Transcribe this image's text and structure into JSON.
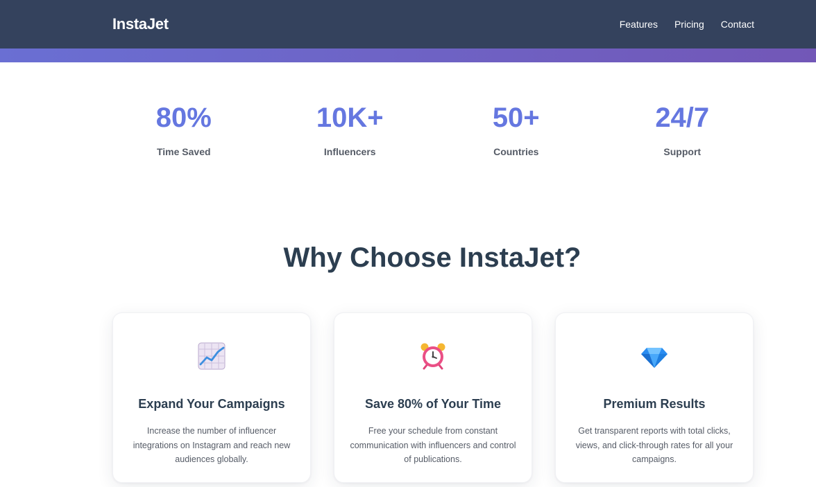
{
  "header": {
    "brand": "InstaJet",
    "nav": [
      "Features",
      "Pricing",
      "Contact"
    ]
  },
  "stats": [
    {
      "value": "80%",
      "label": "Time Saved"
    },
    {
      "value": "10K+",
      "label": "Influencers"
    },
    {
      "value": "50+",
      "label": "Countries"
    },
    {
      "value": "24/7",
      "label": "Support"
    }
  ],
  "section": {
    "title": "Why Choose InstaJet?"
  },
  "features": [
    {
      "icon": "chart-increasing-icon",
      "title": "Expand Your Campaigns",
      "description": "Increase the number of influencer integrations on Instagram and reach new audiences globally."
    },
    {
      "icon": "alarm-clock-icon",
      "title": "Save 80% of Your Time",
      "description": "Free your schedule from constant communication with influencers and control of publications."
    },
    {
      "icon": "gem-icon",
      "title": "Premium Results",
      "description": "Get transparent reports with total clicks, views, and click-through rates for all your campaigns."
    }
  ],
  "colors": {
    "navbar": "#34425d",
    "accent_start": "#6a6fd3",
    "accent_end": "#7257b7",
    "stat_value": "#6577e0",
    "heading": "#2c3e50"
  }
}
